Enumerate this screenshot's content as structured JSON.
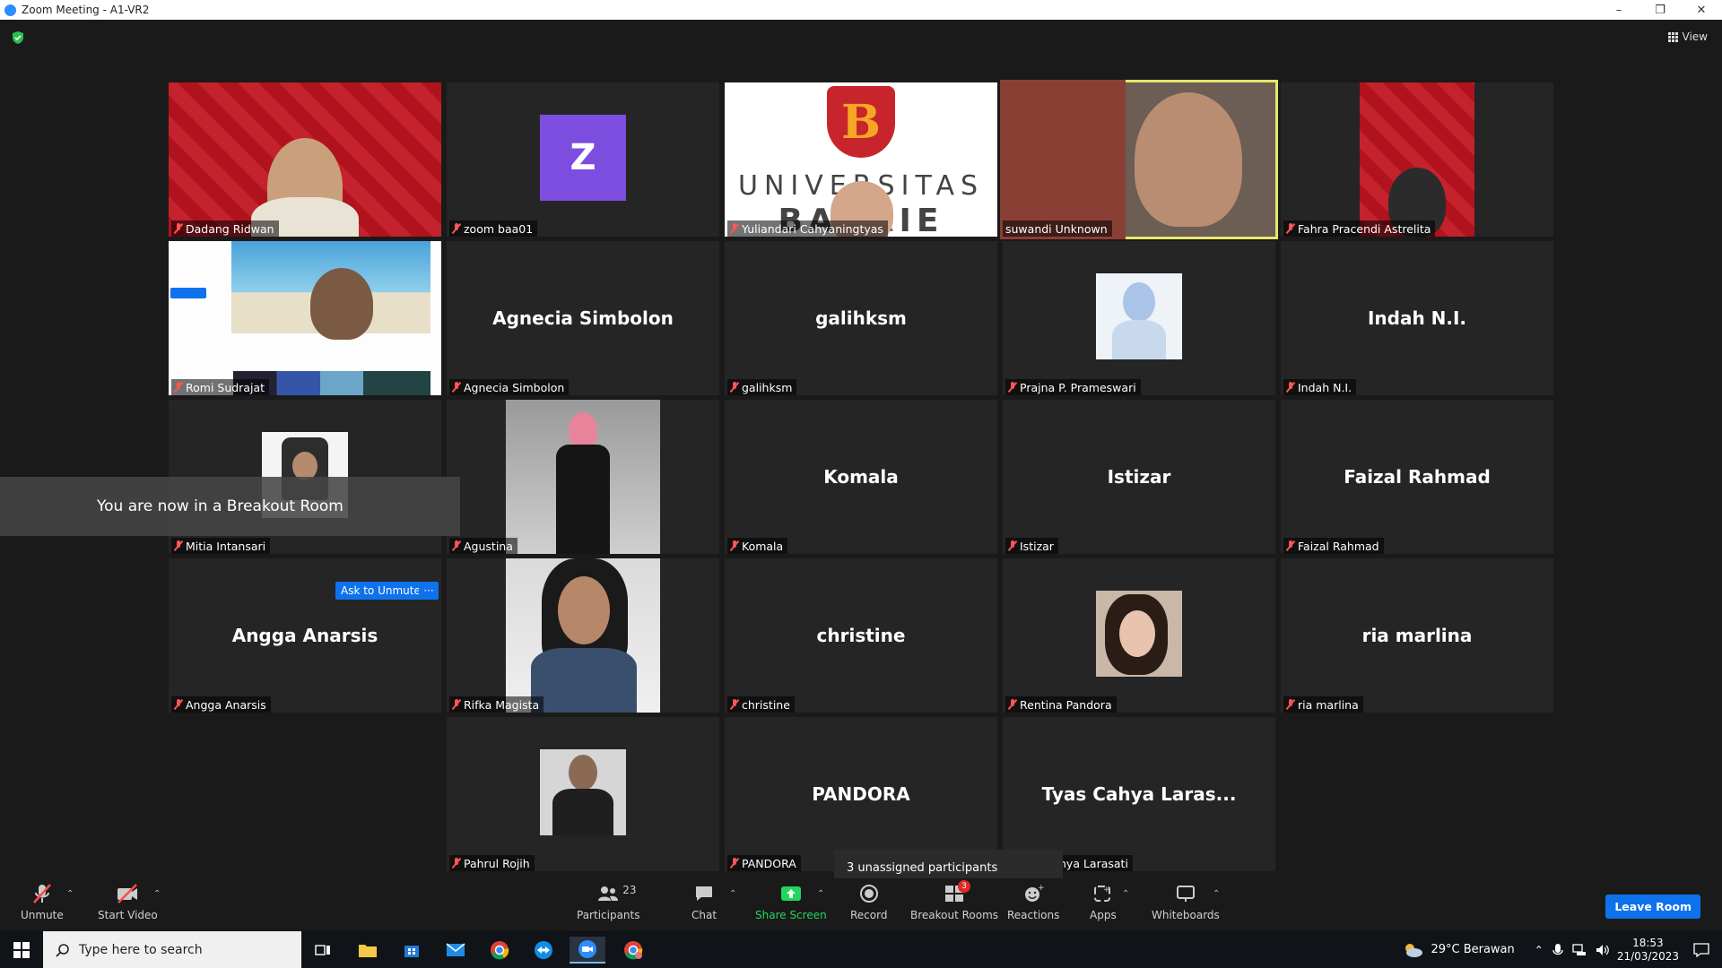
{
  "window": {
    "title": "Zoom Meeting - A1-VR2"
  },
  "header": {
    "view_label": "View"
  },
  "tiles": [
    {
      "name": "Dadang Ridwan"
    },
    {
      "name": "zoom baa01",
      "avatar_letter": "Z"
    },
    {
      "name": "Yuliandari Cahyaningtyas",
      "bg_text_line1": "UNIVERSITAS",
      "bg_text_line2": "BAKRIE"
    },
    {
      "name": "suwandi Unknown"
    },
    {
      "name": "Fahra Pracendi Astrelita"
    },
    {
      "name": "Romi Sudrajat"
    },
    {
      "name": "Agnecia Simbolon",
      "center": "Agnecia Simbolon"
    },
    {
      "name": "galihksm",
      "center": "galihksm"
    },
    {
      "name": "Prajna P. Prameswari"
    },
    {
      "name": "Indah N.I.",
      "center": "Indah N.I."
    },
    {
      "name": "Mitia Intansari"
    },
    {
      "name": "Agustina"
    },
    {
      "name": "Komala",
      "center": "Komala"
    },
    {
      "name": "Istizar",
      "center": "Istizar"
    },
    {
      "name": "Faizal Rahmad",
      "center": "Faizal Rahmad"
    },
    {
      "name": "Angga Anarsis",
      "center": "Angga Anarsis"
    },
    {
      "name": "Rifka Magista"
    },
    {
      "name": "christine",
      "center": "christine"
    },
    {
      "name": "Rentina Pandora"
    },
    {
      "name": "ria marlina",
      "center": "ria marlina"
    },
    {
      "name": "Pahrul Rojih"
    },
    {
      "name": "PANDORA",
      "center": "PANDORA"
    },
    {
      "name": "nya Larasati",
      "center": "Tyas Cahya Laras..."
    }
  ],
  "overlays": {
    "breakout_toast": "You are now in a Breakout Room",
    "ask_to_unmute": "Ask to Unmute",
    "more": "···",
    "unassigned_tooltip": "3 unassigned participants"
  },
  "toolbar": {
    "unmute": "Unmute",
    "start_video": "Start Video",
    "participants": "Participants",
    "participants_count": "23",
    "chat": "Chat",
    "share_screen": "Share Screen",
    "record": "Record",
    "breakout_rooms": "Breakout Rooms",
    "breakout_badge": "3",
    "reactions": "Reactions",
    "apps": "Apps",
    "whiteboards": "Whiteboards",
    "leave_room": "Leave Room"
  },
  "taskbar": {
    "search_placeholder": "Type here to search",
    "weather": "29°C  Berawan",
    "time": "18:53",
    "date": "21/03/2023"
  },
  "colors": {
    "accent_blue": "#0e72ed",
    "share_green": "#22d65e",
    "speaker_outline": "#e5e86a",
    "mute_red": "#ff5555"
  }
}
